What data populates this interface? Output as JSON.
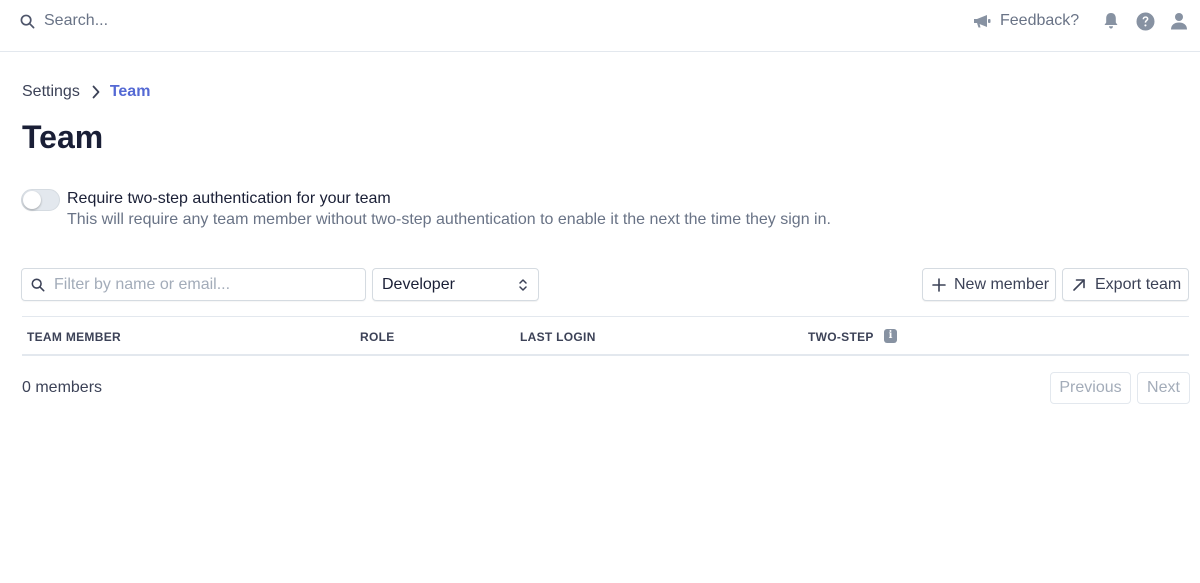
{
  "topbar": {
    "search_label": "Search...",
    "feedback_label": "Feedback?",
    "icons": [
      "search-icon",
      "megaphone-icon",
      "bell-icon",
      "help-icon",
      "user-icon"
    ]
  },
  "breadcrumb": {
    "parent": "Settings",
    "current": "Team"
  },
  "page": {
    "title": "Team"
  },
  "two_step": {
    "enabled": false,
    "title": "Require two-step authentication for your team",
    "description": "This will require any team member without two-step authentication to enable it the next the time they sign in."
  },
  "filters": {
    "search_placeholder": "Filter by name or email...",
    "search_value": "",
    "role_selected": "Developer"
  },
  "actions": {
    "new_member_label": "New member",
    "export_label": "Export team"
  },
  "table": {
    "columns": [
      "TEAM MEMBER",
      "ROLE",
      "LAST LOGIN",
      "TWO-STEP"
    ],
    "rows": []
  },
  "footer": {
    "count_label": "0 members",
    "previous_label": "Previous",
    "next_label": "Next"
  },
  "colors": {
    "accent": "#5469d4",
    "text_primary": "#1a1f36",
    "text_secondary": "#697386",
    "border": "#e3e8ee"
  }
}
